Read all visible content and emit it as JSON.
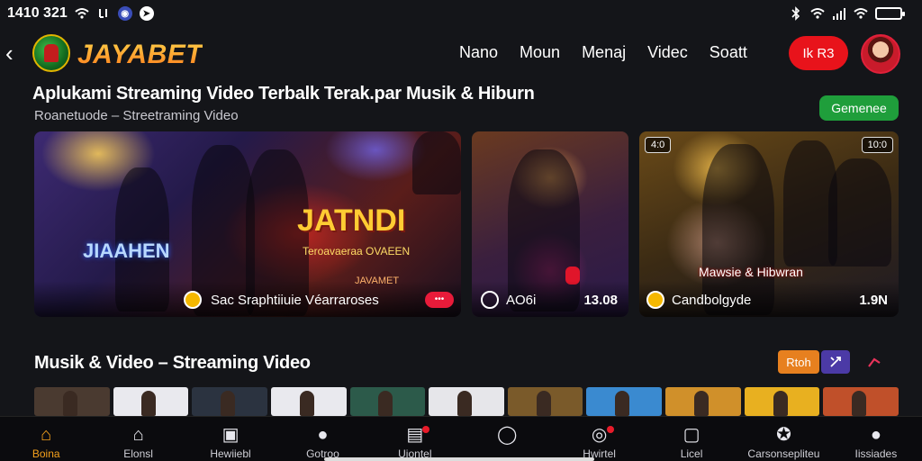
{
  "status_bar": {
    "time": "1410 321",
    "left_icons": [
      "wifi-icon",
      "notification-icon",
      "app-icon",
      "chat-icon"
    ],
    "right_icons": [
      "bluetooth-icon",
      "wifi-icon",
      "signal-icon",
      "wifi-icon",
      "battery-icon"
    ]
  },
  "header": {
    "logo_text": "JAYABET",
    "nav": [
      "Nano",
      "Moun",
      "Menaj",
      "Videc",
      "Soatt"
    ],
    "login_label": "Ik R3"
  },
  "headline": {
    "title": "Aplukami Streaming Video Terbalk Terak.par Musik & Hiburn",
    "subtitle": "Roanetuode – Streetraming Video",
    "button": "Gemenee"
  },
  "featured": [
    {
      "poster_logo": "JAVAMET",
      "poster_title": "JIAAHEN",
      "poster_title2": "JATNDI",
      "poster_sub": "Teroavaeraa OVAEEN",
      "label": "Sac  Sraphtiiuie Véarraroses"
    },
    {
      "tag": "",
      "label": "AO6i",
      "time": "13.08"
    },
    {
      "badge_left": "4:0",
      "badge_right": "10:0",
      "caption": "Mawsie & Hibwran",
      "label": "Candbolgyde",
      "time": "1.9N"
    }
  ],
  "section": {
    "title": "Musik & Video – Streaming Video",
    "btn1": "Rtoh"
  },
  "thumbnail_colors": [
    "#4a3a30",
    "#e9e9ee",
    "#2b3340",
    "#e9e9ee",
    "#2c5a4a",
    "#e6e6ea",
    "#7a5a2a",
    "#3a8ad0",
    "#d0902a",
    "#e8b020",
    "#c0502a"
  ],
  "bottom_nav": [
    {
      "label": "Boina",
      "icon": "home-icon",
      "active": true
    },
    {
      "label": "Elonsl",
      "icon": "house-outline-icon",
      "active": false
    },
    {
      "label": "Hewiiebl",
      "icon": "video-icon",
      "active": false
    },
    {
      "label": "Gotroo",
      "icon": "user-icon",
      "active": false
    },
    {
      "label": "Uiontel",
      "icon": "box-icon",
      "active": false
    },
    {
      "label": "",
      "icon": "chat-bubble-icon",
      "active": false
    },
    {
      "label": "Hwirtel",
      "icon": "disc-icon",
      "active": false
    },
    {
      "label": "Licel",
      "icon": "bookmark-icon",
      "active": false
    },
    {
      "label": "Carsonsepliteu",
      "icon": "award-icon",
      "active": false
    },
    {
      "label": "Iissiades",
      "icon": "profile-icon",
      "active": false
    }
  ]
}
